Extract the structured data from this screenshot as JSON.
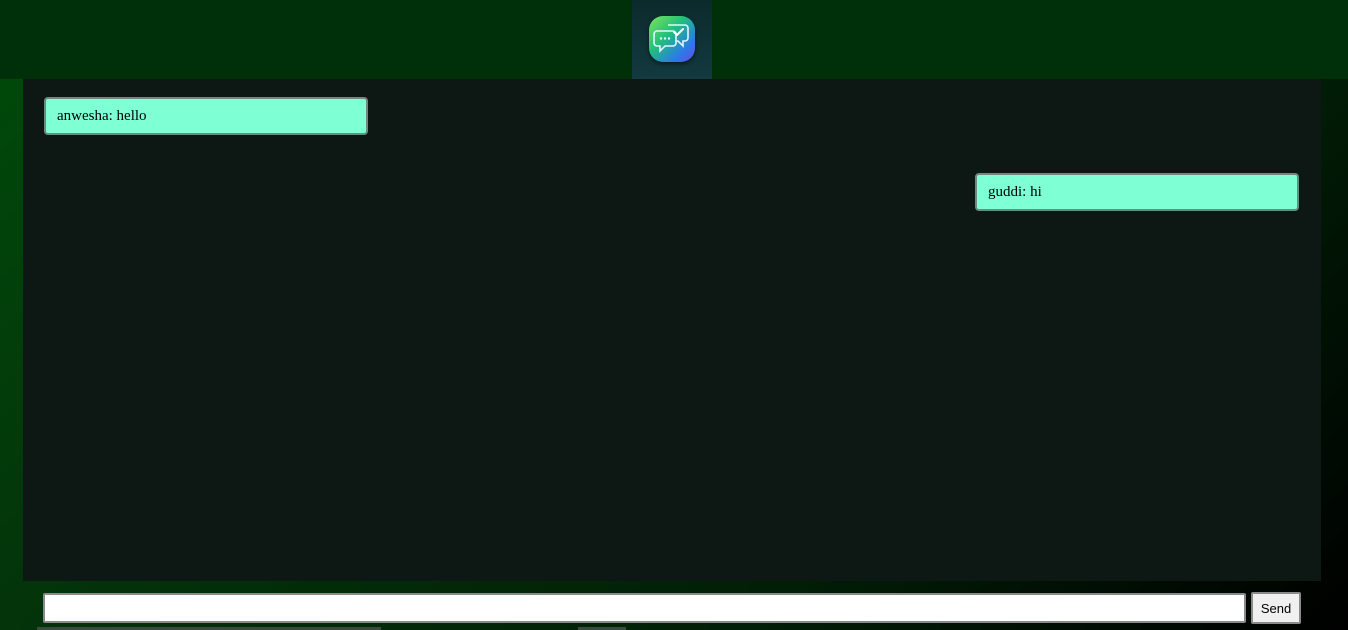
{
  "header": {
    "logo_icon": "chat-bubbles-check-icon",
    "colors": {
      "bar": "#003009",
      "tile": "#0c2a2c"
    }
  },
  "chat": {
    "messages": [
      {
        "sender": "anwesha",
        "text": "anwesha: hello",
        "side": "left"
      },
      {
        "sender": "guddi",
        "text": "guddi: hi",
        "side": "right"
      }
    ],
    "colors": {
      "panel": "#0d1815",
      "bubble": "#7fffd4"
    }
  },
  "composer": {
    "input_value": "",
    "input_placeholder": "",
    "send_label": "Send"
  }
}
